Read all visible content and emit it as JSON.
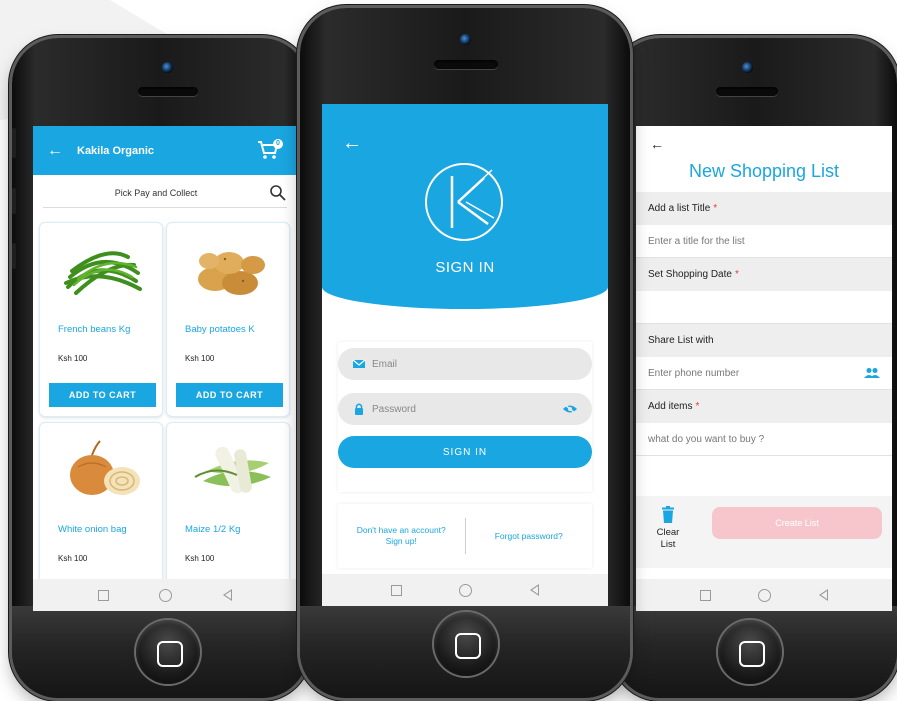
{
  "left_app": {
    "title": "Kakila Organic",
    "cart_count": "0",
    "search_text": "Pick Pay and Collect",
    "products": [
      {
        "name": "French beans Kg",
        "price": "Ksh 100",
        "button": "ADD TO CART",
        "image": "french-beans"
      },
      {
        "name": "Baby potatoes K",
        "price": "Ksh 100",
        "button": "ADD TO CART",
        "image": "potatoes"
      },
      {
        "name": "White onion bag",
        "price": "Ksh 100",
        "image": "onions"
      },
      {
        "name": "Maize 1/2 Kg",
        "price": "Ksh 100",
        "image": "maize"
      }
    ]
  },
  "center_app": {
    "logo_letter": "K",
    "title": "SIGN IN",
    "email_placeholder": "Email",
    "password_placeholder": "Password",
    "signin_button": "SIGN IN",
    "signup_link_line1": "Don't have an account?",
    "signup_link_line2": "Sign up!",
    "forgot_link": "Forgot password?"
  },
  "right_app": {
    "title": "New Shopping List",
    "list_title_label": "Add a list Title",
    "list_title_placeholder": "Enter a title for the list",
    "date_label": "Set Shopping Date",
    "share_label": "Share List with",
    "phone_placeholder": "Enter phone number",
    "items_label": "Add items",
    "items_placeholder": "what do you want to buy ?",
    "required_mark": "*",
    "clear_line1": "Clear",
    "clear_line2": "List",
    "create_button": "Create List"
  },
  "colors": {
    "brand_blue": "#1aa6e0",
    "create_disabled": "#f7c6cc",
    "required": "#e53935"
  }
}
